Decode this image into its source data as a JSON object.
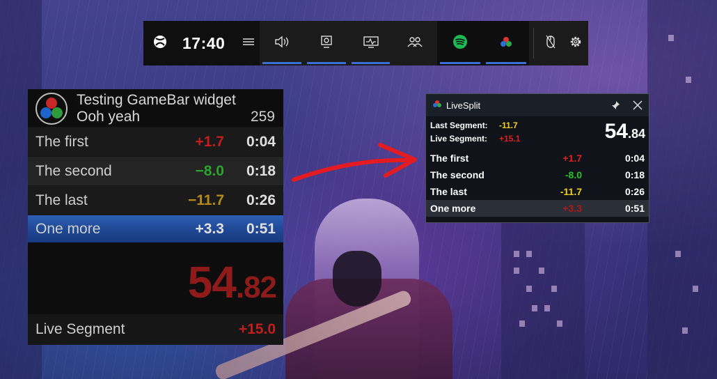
{
  "gamebar": {
    "time": "17:40",
    "colors": {
      "active_underline": "#3a6fd8",
      "spotify": "#1db954"
    }
  },
  "widget": {
    "title": "Testing GameBar widget",
    "subtitle": "Ooh yeah",
    "attempts": "259",
    "splits": [
      {
        "name": "The first",
        "delta": "+1.7",
        "time": "0:04",
        "delta_color": "#c41d1d"
      },
      {
        "name": "The second",
        "delta": "−8.0",
        "time": "0:18",
        "delta_color": "#2aa42a"
      },
      {
        "name": "The last",
        "delta": "−11.7",
        "time": "0:26",
        "delta_color": "#b58a18"
      },
      {
        "name": "One more",
        "delta": "+3.3",
        "time": "0:51",
        "delta_color": "#e0e0e0"
      }
    ],
    "timer_main": "54",
    "timer_cents": ".82",
    "live_label": "Live Segment",
    "live_value": "+15.0"
  },
  "livesplit": {
    "title": "LiveSplit",
    "last_segment_label": "Last Segment:",
    "last_segment_value": "-11.7",
    "live_segment_label": "Live Segment:",
    "live_segment_value": "+15.1",
    "timer_main": "54",
    "timer_cents": ".84",
    "splits": [
      {
        "name": "The first",
        "delta": "+1.7",
        "time": "0:04",
        "delta_color": "#e02020"
      },
      {
        "name": "The second",
        "delta": "-8.0",
        "time": "0:18",
        "delta_color": "#27c227"
      },
      {
        "name": "The last",
        "delta": "-11.7",
        "time": "0:26",
        "delta_color": "#f0d21e"
      },
      {
        "name": "One more",
        "delta": "+3.3",
        "time": "0:51",
        "delta_color": "#b01818"
      }
    ]
  },
  "icons": {
    "gamebar": [
      "xbox-icon",
      "menu-icon",
      "audio-icon",
      "capture-icon",
      "performance-icon",
      "social-icon",
      "spotify-icon",
      "livesplit-icon",
      "mouse-icon",
      "settings-icon"
    ],
    "livesplit": [
      "livesplit-logo-icon",
      "pin-icon",
      "close-icon"
    ]
  }
}
